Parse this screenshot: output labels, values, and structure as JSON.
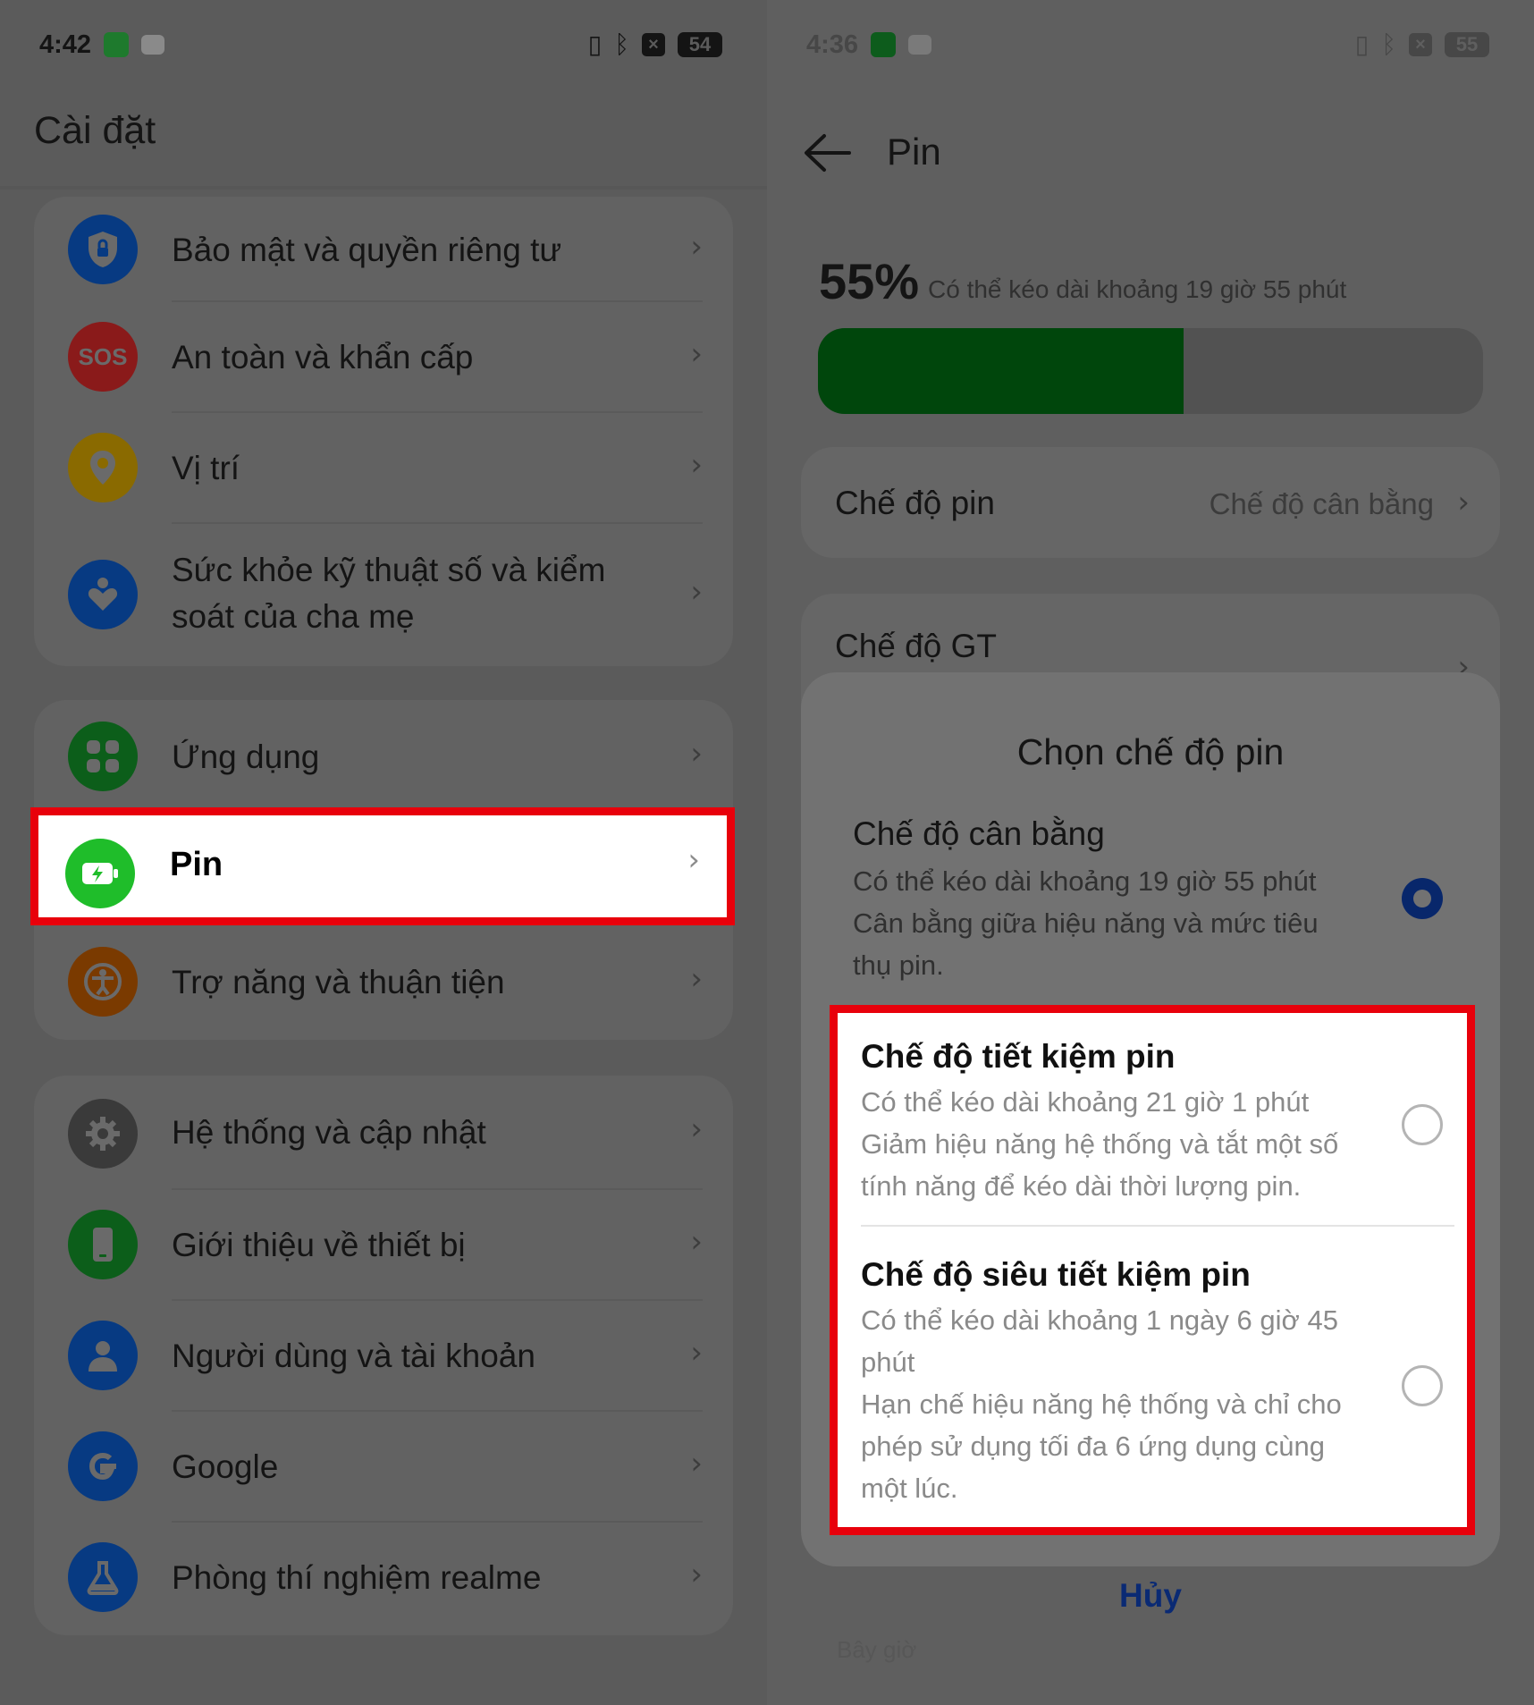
{
  "left": {
    "status": {
      "time": "4:42",
      "battery": "54"
    },
    "title": "Cài đặt",
    "groups": [
      {
        "items": [
          {
            "label": "Bảo mật và quyền riêng tư",
            "icon": "shield-lock-icon",
            "color": "#073a82"
          },
          {
            "label": "An toàn và khẩn cấp",
            "icon": "sos-icon",
            "color": "#8a1a1a",
            "glyph": "SOS"
          },
          {
            "label": "Vị trí",
            "icon": "location-pin-icon",
            "color": "#8a6a00"
          },
          {
            "label": "Sức khỏe kỹ thuật số và kiểm soát của cha mẹ",
            "icon": "digital-wellbeing-icon",
            "color": "#073a82"
          }
        ]
      },
      {
        "items": [
          {
            "label": "Ứng dụng",
            "icon": "apps-grid-icon",
            "color": "#0c5e1a"
          },
          {
            "label": "Pin",
            "icon": "battery-charging-icon",
            "color": "#1fbd2a",
            "highlighted": true
          },
          {
            "label": "Trợ năng và thuận tiện",
            "icon": "accessibility-icon",
            "color": "#7a3a00"
          }
        ]
      },
      {
        "items": [
          {
            "label": "Hệ thống và cập nhật",
            "icon": "gear-icon",
            "color": "#3a3a3a"
          },
          {
            "label": "Giới thiệu về thiết bị",
            "icon": "phone-icon",
            "color": "#0c5e1a"
          },
          {
            "label": "Người dùng và tài khoản",
            "icon": "user-icon",
            "color": "#073a82"
          },
          {
            "label": "Google",
            "icon": "google-icon",
            "color": "#073a82"
          },
          {
            "label": "Phòng thí nghiệm realme",
            "icon": "flask-icon",
            "color": "#073a82"
          }
        ]
      }
    ]
  },
  "right": {
    "status": {
      "time": "4:36",
      "battery": "55"
    },
    "title": "Pin",
    "battery_percent_label": "55%",
    "battery_fraction": 0.55,
    "battery_note": "Có thể kéo dài khoảng 19 giờ 55 phút",
    "mode_row": {
      "label": "Chế độ pin",
      "value": "Chế độ cân bằng"
    },
    "gt_row": {
      "label": "Chế độ GT"
    },
    "sheet": {
      "title": "Chọn chế độ pin",
      "options": [
        {
          "title": "Chế độ cân bằng",
          "desc": "Có thể kéo dài khoảng 19 giờ 55 phút\nCân bằng giữa hiệu năng và mức tiêu thụ pin.",
          "selected": true
        },
        {
          "title": "Chế độ tiết kiệm pin",
          "desc": "Có thể kéo dài khoảng 21 giờ 1 phút\nGiảm hiệu năng hệ thống và tắt một số tính năng để kéo dài thời lượng pin.",
          "selected": false
        },
        {
          "title": "Chế độ siêu tiết kiệm pin",
          "desc": "Có thể kéo dài khoảng 1 ngày 6 giờ 45 phút\nHạn chế hiệu năng hệ thống và chỉ cho phép sử dụng tối đa 6 ứng dụng cùng một lúc.",
          "selected": false
        }
      ],
      "cancel": "Hủy"
    },
    "faint_footer": "Bây giờ"
  }
}
